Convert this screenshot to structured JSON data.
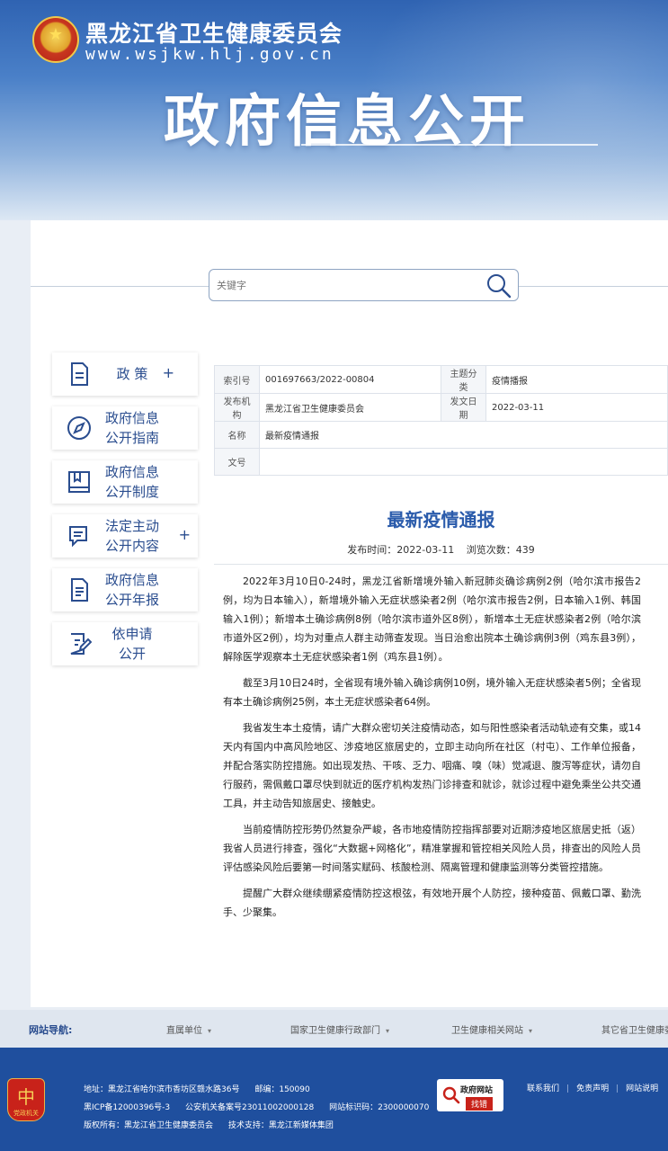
{
  "header": {
    "site_name": "黑龙江省卫生健康委员会",
    "site_url": "www.wsjkw.hlj.gov.cn",
    "hero_title": "政府信息公开"
  },
  "search": {
    "placeholder": "关键字"
  },
  "sidebar": {
    "items": [
      {
        "label": "政 策",
        "plus": "+"
      },
      {
        "label": "政府信息\n公开指南"
      },
      {
        "label": "政府信息\n公开制度"
      },
      {
        "label": "法定主动\n公开内容",
        "plus": "+"
      },
      {
        "label": "政府信息\n公开年报"
      },
      {
        "label": "依申请\n公开"
      }
    ]
  },
  "meta": {
    "index_label": "索引号",
    "index_value": "001697663/2022-00804",
    "topic_label": "主题分类",
    "topic_value": "疫情播报",
    "org_label": "发布机构",
    "org_value": "黑龙江省卫生健康委员会",
    "date_label": "发文日期",
    "date_value": "2022-03-11",
    "name_label": "名称",
    "name_value": "最新疫情通报",
    "doc_label": "文号",
    "doc_value": ""
  },
  "article": {
    "title": "最新疫情通报",
    "publish_time": "发布时间：2022-03-11",
    "views": "浏览次数：439",
    "paragraphs": [
      "2022年3月10日0-24时，黑龙江省新增境外输入新冠肺炎确诊病例2例（哈尔滨市报告2例，均为日本输入），新增境外输入无症状感染者2例（哈尔滨市报告2例，日本输入1例、韩国输入1例）；新增本土确诊病例8例（哈尔滨市道外区8例），新增本土无症状感染者2例（哈尔滨市道外区2例），均为对重点人群主动筛查发现。当日治愈出院本土确诊病例3例（鸡东县3例），解除医学观察本土无症状感染者1例（鸡东县1例）。",
      "截至3月10日24时，全省现有境外输入确诊病例10例，境外输入无症状感染者5例；全省现有本土确诊病例25例，本土无症状感染者64例。",
      "我省发生本土疫情，请广大群众密切关注疫情动态，如与阳性感染者活动轨迹有交集，或14天内有国内中高风险地区、涉疫地区旅居史的，立即主动向所在社区（村屯）、工作单位报备，并配合落实防控措施。如出现发热、干咳、乏力、咽痛、嗅（味）觉减退、腹泻等症状，请勿自行服药，需佩戴口罩尽快到就近的医疗机构发热门诊排查和就诊，就诊过程中避免乘坐公共交通工具，并主动告知旅居史、接触史。",
      "当前疫情防控形势仍然复杂严峻，各市地疫情防控指挥部要对近期涉疫地区旅居史抵（返）我省人员进行排查，强化“大数据+网格化”，精准掌握和管控相关风险人员，排查出的风险人员评估感染风险后要第一时间落实赋码、核酸检测、隔离管理和健康监测等分类管控措施。",
      "提醒广大群众继续绷紧疫情防控这根弦，有效地开展个人防控，接种疫苗、佩戴口罩、勤洗手、少聚集。"
    ]
  },
  "navbar": {
    "title": "网站导航:",
    "links": [
      "直属单位",
      "国家卫生健康行政部门",
      "卫生健康相关网站",
      "其它省卫生健康委"
    ]
  },
  "footer": {
    "party_caption": "党政机关",
    "address": "地址：黑龙江省哈尔滨市香坊区赣水路36号",
    "postcode": "邮编：150090",
    "icp": "黑ICP备12000396号-3",
    "police": "公安机关备案号23011002000128",
    "site_id": "网站标识码：2300000070",
    "copyright": "版权所有：黑龙江省卫生健康委员会",
    "support": "技术支持：黑龙江新媒体集团",
    "badge_top": "政府网站",
    "badge_bottom": "找错",
    "links": [
      "联系我们",
      "免责声明",
      "网站说明"
    ]
  }
}
